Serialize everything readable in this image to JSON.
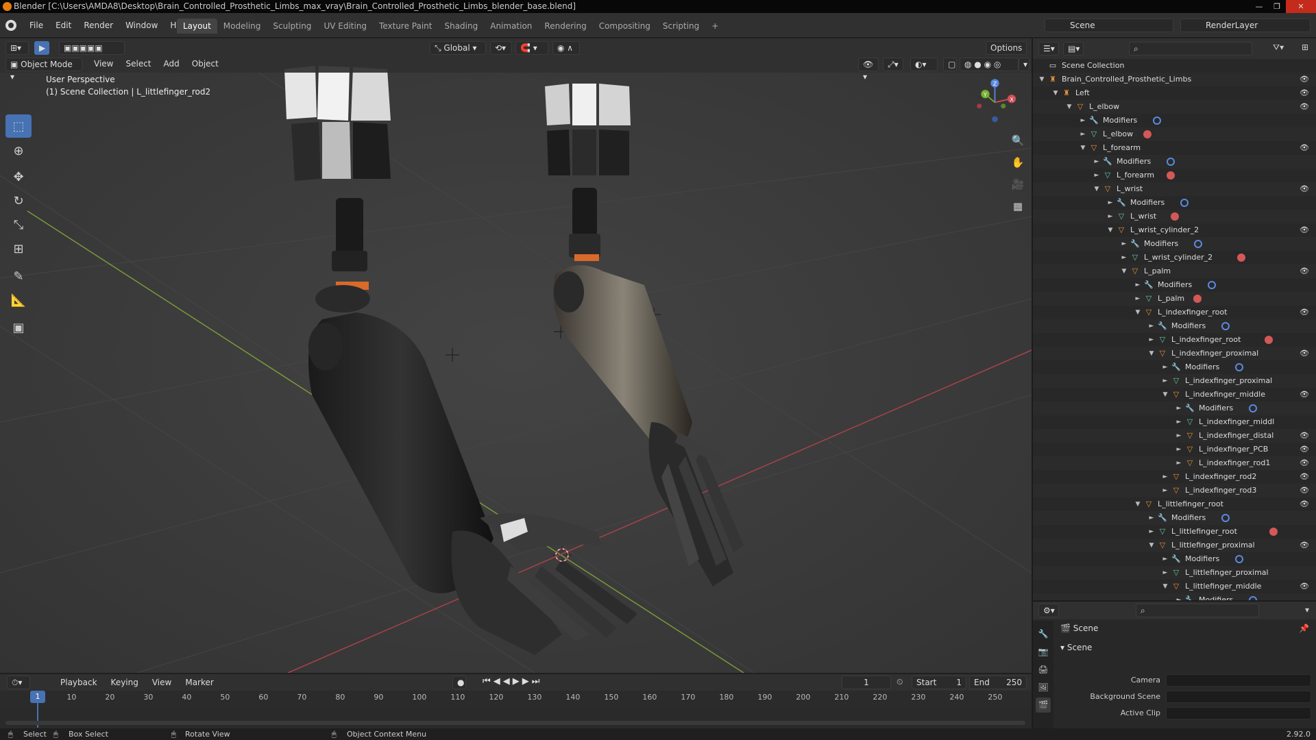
{
  "window": {
    "title": "Blender [C:\\Users\\AMDA8\\Desktop\\Brain_Controlled_Prosthetic_Limbs_max_vray\\Brain_Controlled_Prosthetic_Limbs_blender_base.blend]",
    "minimize": "—",
    "maximize": "❐",
    "close": "✕"
  },
  "menubar": {
    "items": [
      "File",
      "Edit",
      "Render",
      "Window",
      "Help"
    ],
    "workspaces": [
      "Layout",
      "Modeling",
      "Sculpting",
      "UV Editing",
      "Texture Paint",
      "Shading",
      "Animation",
      "Rendering",
      "Compositing",
      "Scripting"
    ],
    "add_workspace": "+",
    "scene": "Scene",
    "render_layer": "RenderLayer"
  },
  "viewport": {
    "orientation": "Global",
    "options": "Options",
    "mode": "Object Mode",
    "header_menus": [
      "View",
      "Select",
      "Add",
      "Object"
    ],
    "perspective_label": "User Perspective",
    "collection_label": "(1) Scene Collection | L_littlefinger_rod2",
    "gizmo_labels": {
      "x": "X",
      "y": "Y",
      "z": "Z"
    }
  },
  "timeline": {
    "menus": [
      "Playback",
      "Keying",
      "View",
      "Marker"
    ],
    "current_frame": "1",
    "start_label": "Start",
    "start_value": "1",
    "end_label": "End",
    "end_value": "250",
    "ruler": [
      "1",
      "10",
      "20",
      "30",
      "40",
      "50",
      "60",
      "70",
      "80",
      "90",
      "100",
      "110",
      "120",
      "130",
      "140",
      "150",
      "160",
      "170",
      "180",
      "190",
      "200",
      "210",
      "220",
      "230",
      "240",
      "250"
    ]
  },
  "statusbar": {
    "select": "Select",
    "box_select": "Box Select",
    "rotate_view": "Rotate View",
    "context_menu": "Object Context Menu",
    "version": "2.92.0"
  },
  "outliner": {
    "rows": [
      {
        "label": "Scene Collection",
        "icon": "collection-icon",
        "depth": 0,
        "arrow": "",
        "eye": false,
        "badge": ""
      },
      {
        "label": "Brain_Controlled_Prosthetic_Limbs",
        "icon": "armature-icon",
        "depth": 0,
        "arrow": "▼",
        "eye": true,
        "badge": ""
      },
      {
        "label": "Left",
        "icon": "armature-icon",
        "depth": 1,
        "arrow": "▼",
        "eye": true,
        "badge": ""
      },
      {
        "label": "L_elbow",
        "icon": "empty-icon",
        "depth": 2,
        "arrow": "▼",
        "eye": true,
        "badge": ""
      },
      {
        "label": "Modifiers",
        "icon": "wrench-icon",
        "depth": 3,
        "arrow": "►",
        "eye": false,
        "badge": "blue"
      },
      {
        "label": "L_elbow",
        "icon": "mesh-icon",
        "depth": 3,
        "arrow": "►",
        "eye": false,
        "badge": "red"
      },
      {
        "label": "L_forearm",
        "icon": "empty-icon",
        "depth": 3,
        "arrow": "▼",
        "eye": true,
        "badge": ""
      },
      {
        "label": "Modifiers",
        "icon": "wrench-icon",
        "depth": 4,
        "arrow": "►",
        "eye": false,
        "badge": "blue"
      },
      {
        "label": "L_forearm",
        "icon": "mesh-icon",
        "depth": 4,
        "arrow": "►",
        "eye": false,
        "badge": "red"
      },
      {
        "label": "L_wrist",
        "icon": "empty-icon",
        "depth": 4,
        "arrow": "▼",
        "eye": true,
        "badge": ""
      },
      {
        "label": "Modifiers",
        "icon": "wrench-icon",
        "depth": 5,
        "arrow": "►",
        "eye": false,
        "badge": "blue"
      },
      {
        "label": "L_wrist",
        "icon": "mesh-icon",
        "depth": 5,
        "arrow": "►",
        "eye": false,
        "badge": "red"
      },
      {
        "label": "L_wrist_cylinder_2",
        "icon": "empty-icon",
        "depth": 5,
        "arrow": "▼",
        "eye": true,
        "badge": ""
      },
      {
        "label": "Modifiers",
        "icon": "wrench-icon",
        "depth": 6,
        "arrow": "►",
        "eye": false,
        "badge": "blue"
      },
      {
        "label": "L_wrist_cylinder_2",
        "icon": "mesh-icon",
        "depth": 6,
        "arrow": "►",
        "eye": false,
        "badge": "red"
      },
      {
        "label": "L_palm",
        "icon": "empty-icon",
        "depth": 6,
        "arrow": "▼",
        "eye": true,
        "badge": ""
      },
      {
        "label": "Modifiers",
        "icon": "wrench-icon",
        "depth": 7,
        "arrow": "►",
        "eye": false,
        "badge": "blue"
      },
      {
        "label": "L_palm",
        "icon": "mesh-icon",
        "depth": 7,
        "arrow": "►",
        "eye": false,
        "badge": "red"
      },
      {
        "label": "L_indexfinger_root",
        "icon": "empty-icon",
        "depth": 7,
        "arrow": "▼",
        "eye": true,
        "badge": ""
      },
      {
        "label": "Modifiers",
        "icon": "wrench-icon",
        "depth": 8,
        "arrow": "►",
        "eye": false,
        "badge": "blue"
      },
      {
        "label": "L_indexfinger_root",
        "icon": "mesh-icon",
        "depth": 8,
        "arrow": "►",
        "eye": false,
        "badge": "red"
      },
      {
        "label": "L_indexfinger_proximal",
        "icon": "empty-icon",
        "depth": 8,
        "arrow": "▼",
        "eye": true,
        "badge": ""
      },
      {
        "label": "Modifiers",
        "icon": "wrench-icon",
        "depth": 9,
        "arrow": "►",
        "eye": false,
        "badge": "blue"
      },
      {
        "label": "L_indexfinger_proximal",
        "icon": "mesh-icon",
        "depth": 9,
        "arrow": "►",
        "eye": false,
        "badge": ""
      },
      {
        "label": "L_indexfinger_middle",
        "icon": "empty-icon",
        "depth": 9,
        "arrow": "▼",
        "eye": true,
        "badge": ""
      },
      {
        "label": "Modifiers",
        "icon": "wrench-icon",
        "depth": 10,
        "arrow": "►",
        "eye": false,
        "badge": "blue"
      },
      {
        "label": "L_indexfinger_middl",
        "icon": "mesh-icon",
        "depth": 10,
        "arrow": "►",
        "eye": false,
        "badge": ""
      },
      {
        "label": "L_indexfinger_distal",
        "icon": "empty-icon",
        "depth": 10,
        "arrow": "►",
        "eye": true,
        "badge": ""
      },
      {
        "label": "L_indexfinger_PCB",
        "icon": "empty-icon",
        "depth": 10,
        "arrow": "►",
        "eye": true,
        "badge": ""
      },
      {
        "label": "L_indexfinger_rod1",
        "icon": "empty-icon",
        "depth": 10,
        "arrow": "►",
        "eye": true,
        "badge": ""
      },
      {
        "label": "L_indexfinger_rod2",
        "icon": "empty-icon",
        "depth": 9,
        "arrow": "►",
        "eye": true,
        "badge": ""
      },
      {
        "label": "L_indexfinger_rod3",
        "icon": "empty-icon",
        "depth": 9,
        "arrow": "►",
        "eye": true,
        "badge": ""
      },
      {
        "label": "L_littlefinger_root",
        "icon": "empty-icon",
        "depth": 7,
        "arrow": "▼",
        "eye": true,
        "badge": ""
      },
      {
        "label": "Modifiers",
        "icon": "wrench-icon",
        "depth": 8,
        "arrow": "►",
        "eye": false,
        "badge": "blue"
      },
      {
        "label": "L_littlefinger_root",
        "icon": "mesh-icon",
        "depth": 8,
        "arrow": "►",
        "eye": false,
        "badge": "red"
      },
      {
        "label": "L_littlefinger_proximal",
        "icon": "empty-icon",
        "depth": 8,
        "arrow": "▼",
        "eye": true,
        "badge": ""
      },
      {
        "label": "Modifiers",
        "icon": "wrench-icon",
        "depth": 9,
        "arrow": "►",
        "eye": false,
        "badge": "blue"
      },
      {
        "label": "L_littlefinger_proximal",
        "icon": "mesh-icon",
        "depth": 9,
        "arrow": "►",
        "eye": false,
        "badge": ""
      },
      {
        "label": "L_littlefinger_middle",
        "icon": "empty-icon",
        "depth": 9,
        "arrow": "▼",
        "eye": true,
        "badge": ""
      },
      {
        "label": "Modifiers",
        "icon": "wrench-icon",
        "depth": 10,
        "arrow": "►",
        "eye": false,
        "badge": "blue"
      }
    ]
  },
  "properties": {
    "breadcrumb": "Scene",
    "panel_title": "Scene",
    "fields": [
      {
        "label": "Camera",
        "value": ""
      },
      {
        "label": "Background Scene",
        "value": ""
      },
      {
        "label": "Active Clip",
        "value": ""
      }
    ]
  },
  "colors": {
    "accent": "#4772b3",
    "empty_object": "#e8903a",
    "mesh": "#69c7a8",
    "modifier": "#6d98e8"
  }
}
